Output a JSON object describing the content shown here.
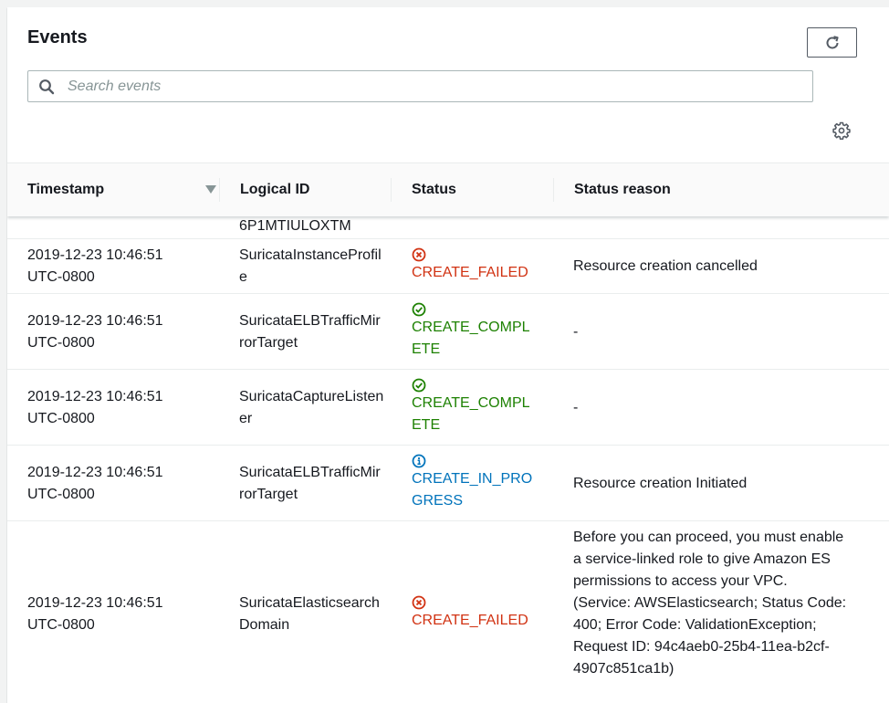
{
  "panel": {
    "title": "Events",
    "search_placeholder": "Search events"
  },
  "columns": {
    "timestamp": "Timestamp",
    "logical_id": "Logical ID",
    "status": "Status",
    "status_reason": "Status reason"
  },
  "partial_row": {
    "logical_id": "6P1MTIULOXTM"
  },
  "rows": [
    {
      "timestamp_line1": "2019-12-23 10:46:51",
      "timestamp_line2": "UTC-0800",
      "logical_id": "SuricataInstanceProfile",
      "status": "CREATE_FAILED",
      "status_icon": "error-circle-icon",
      "status_reason": "Resource creation cancelled"
    },
    {
      "timestamp_line1": "2019-12-23 10:46:51",
      "timestamp_line2": "UTC-0800",
      "logical_id": "SuricataELBTrafficMirrorTarget",
      "status": "CREATE_COMPLETE",
      "status_icon": "success-check-icon",
      "status_reason": "-"
    },
    {
      "timestamp_line1": "2019-12-23 10:46:51",
      "timestamp_line2": "UTC-0800",
      "logical_id": "SuricataCaptureListener",
      "status": "CREATE_COMPLETE",
      "status_icon": "success-check-icon",
      "status_reason": "-"
    },
    {
      "timestamp_line1": "2019-12-23 10:46:51",
      "timestamp_line2": "UTC-0800",
      "logical_id": "SuricataELBTrafficMirrorTarget",
      "status": "CREATE_IN_PROGRESS",
      "status_icon": "info-circle-icon",
      "status_reason": "Resource creation Initiated"
    },
    {
      "timestamp_line1": "2019-12-23 10:46:51",
      "timestamp_line2": "UTC-0800",
      "logical_id": "SuricataElasticsearchDomain",
      "status": "CREATE_FAILED",
      "status_icon": "error-circle-icon",
      "status_reason": "Before you can proceed, you must enable a service-linked role to give Amazon ES permissions to access your VPC. (Service: AWSElasticsearch; Status Code: 400; Error Code: ValidationException; Request ID: 94c4aeb0-25b4-11ea-b2cf-4907c851ca1b)"
    }
  ],
  "colors": {
    "failed": "#d13212",
    "complete": "#1d8102",
    "in_progress": "#0073bb"
  }
}
